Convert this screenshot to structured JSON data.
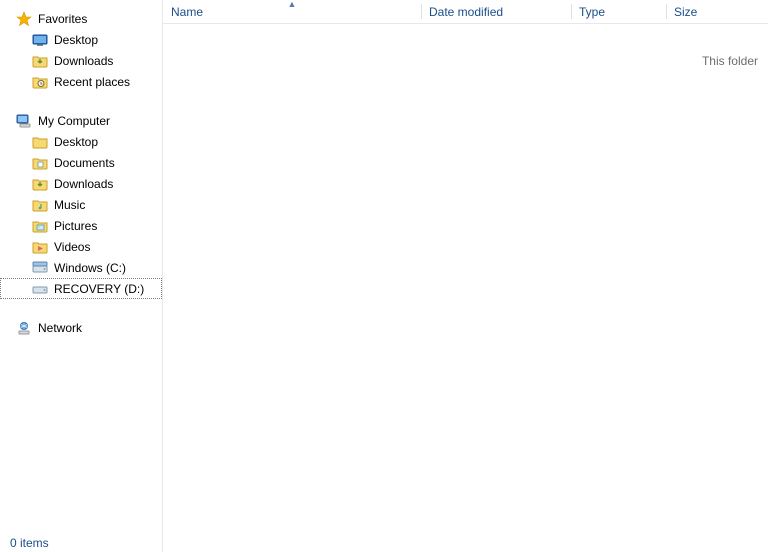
{
  "sidebar": {
    "groups": [
      {
        "header": {
          "label": "Favorites",
          "icon": "star-icon"
        },
        "items": [
          {
            "label": "Desktop",
            "icon": "desktop-icon"
          },
          {
            "label": "Downloads",
            "icon": "folder-download-icon"
          },
          {
            "label": "Recent places",
            "icon": "recent-icon"
          }
        ]
      },
      {
        "header": {
          "label": "My Computer",
          "icon": "computer-icon"
        },
        "items": [
          {
            "label": "Desktop",
            "icon": "folder-icon"
          },
          {
            "label": "Documents",
            "icon": "folder-doc-icon"
          },
          {
            "label": "Downloads",
            "icon": "folder-download-icon"
          },
          {
            "label": "Music",
            "icon": "folder-music-icon"
          },
          {
            "label": "Pictures",
            "icon": "folder-picture-icon"
          },
          {
            "label": "Videos",
            "icon": "folder-video-icon"
          },
          {
            "label": "Windows (C:)",
            "icon": "drive-icon"
          },
          {
            "label": "RECOVERY (D:)",
            "icon": "drive-icon",
            "selected": true
          }
        ]
      },
      {
        "header": {
          "label": "Network",
          "icon": "network-icon"
        },
        "items": []
      }
    ]
  },
  "columns": {
    "name": "Name",
    "date": "Date modified",
    "type": "Type",
    "size": "Size",
    "sort": {
      "column": "name",
      "dir": "asc"
    }
  },
  "content": {
    "hint": "This folder"
  },
  "status": {
    "text": "0 items"
  }
}
